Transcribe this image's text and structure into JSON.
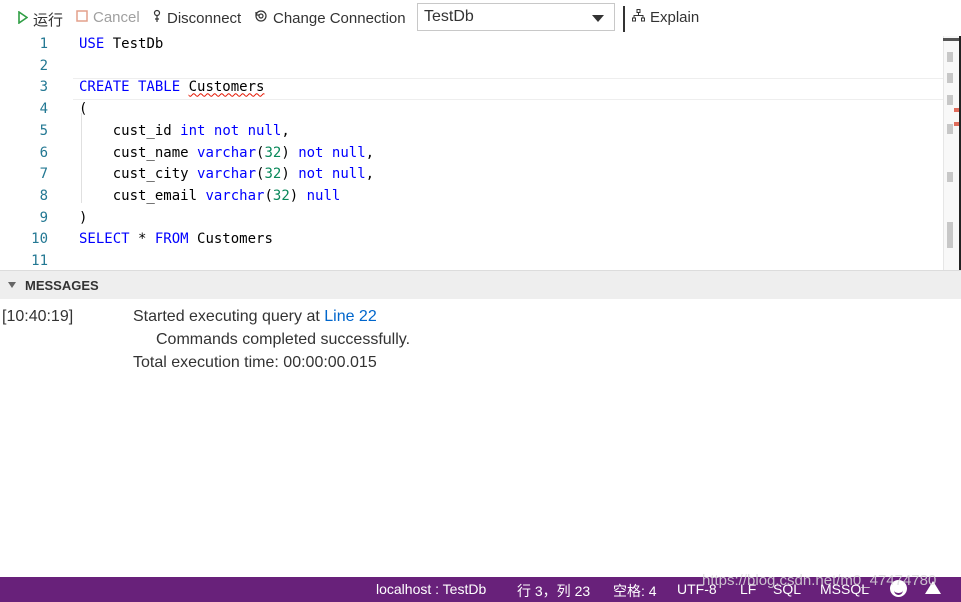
{
  "toolbar": {
    "run_label": "运行",
    "cancel_label": "Cancel",
    "disconnect_label": "Disconnect",
    "change_connection_label": "Change Connection",
    "database_selected": "TestDb",
    "explain_label": "Explain"
  },
  "editor": {
    "lines": [
      {
        "num": "1",
        "text": "USE TestDb"
      },
      {
        "num": "2",
        "text": ""
      },
      {
        "num": "3",
        "text": "CREATE TABLE Customers"
      },
      {
        "num": "4",
        "text": "("
      },
      {
        "num": "5",
        "text": "    cust_id int not null,"
      },
      {
        "num": "6",
        "text": "    cust_name varchar(32) not null,"
      },
      {
        "num": "7",
        "text": "    cust_city varchar(32) not null,"
      },
      {
        "num": "8",
        "text": "    cust_email varchar(32) null"
      },
      {
        "num": "9",
        "text": ")"
      },
      {
        "num": "10",
        "text": "SELECT * FROM Customers"
      },
      {
        "num": "11",
        "text": ""
      }
    ]
  },
  "messages": {
    "header": "MESSAGES",
    "timestamp": "[10:40:19]",
    "started_text": "Started executing query at ",
    "line_link": "Line 22",
    "completed_text": "Commands completed successfully.",
    "execution_time": "Total execution time: 00:00:00.015"
  },
  "statusbar": {
    "connection": "localhost : TestDb",
    "position": "行 3，列 23",
    "spaces": "空格: 4",
    "encoding": "UTF-8",
    "eol": "LF",
    "language": "SQL",
    "provider": "MSSQL",
    "watermark": "https://blog.csdn.net/m0_47474780",
    "color": "#68217a"
  }
}
